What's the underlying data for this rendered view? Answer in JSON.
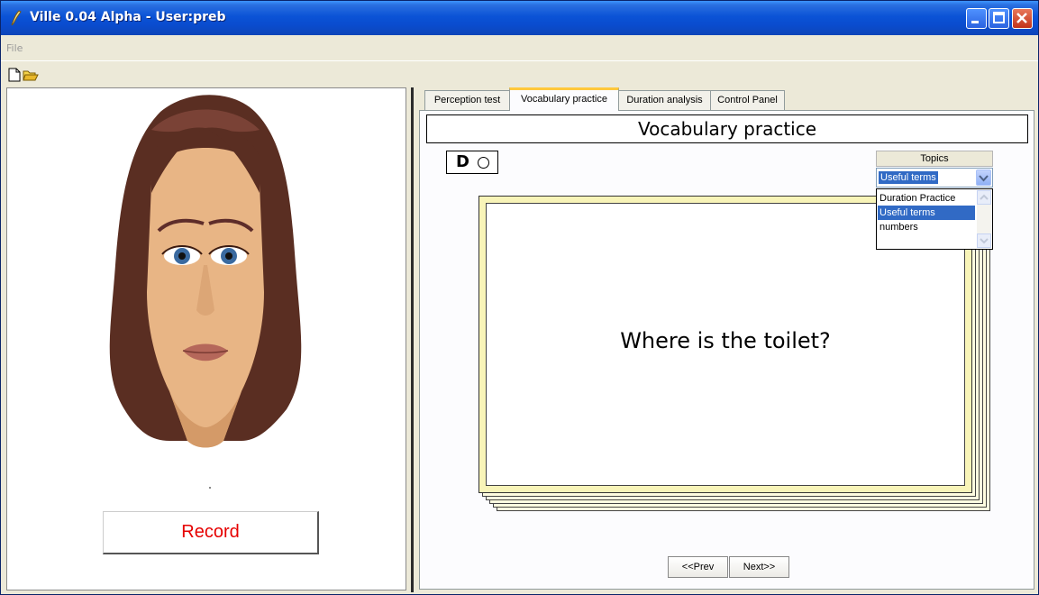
{
  "window": {
    "title": "Ville 0.04 Alpha - User:preb"
  },
  "menu": {
    "file": "File"
  },
  "left": {
    "record_label": "Record",
    "record_color": "#e60000"
  },
  "tabs": [
    {
      "label": "Perception test",
      "active": false
    },
    {
      "label": "Vocabulary practice",
      "active": true
    },
    {
      "label": "Duration analysis",
      "active": false
    },
    {
      "label": "Control Panel",
      "active": false
    }
  ],
  "practice": {
    "title": "Vocabulary practice",
    "indicator_letter": "D",
    "card_text": "Where is the toilet?",
    "prev_label": "<<Prev",
    "next_label": "Next>>"
  },
  "topics": {
    "label": "Topics",
    "selected": "Useful terms",
    "options": [
      "Duration Practice",
      "Useful terms",
      "numbers"
    ],
    "selected_index": 1
  },
  "icons": {
    "app": "quill-pen-icon",
    "new": "new-document-icon",
    "open": "open-folder-icon"
  },
  "colors": {
    "titlebar": "#0b53d6",
    "selection": "#316ac5",
    "tab_highlight": "#ffc83c",
    "card_border": "#f8f4b8"
  }
}
